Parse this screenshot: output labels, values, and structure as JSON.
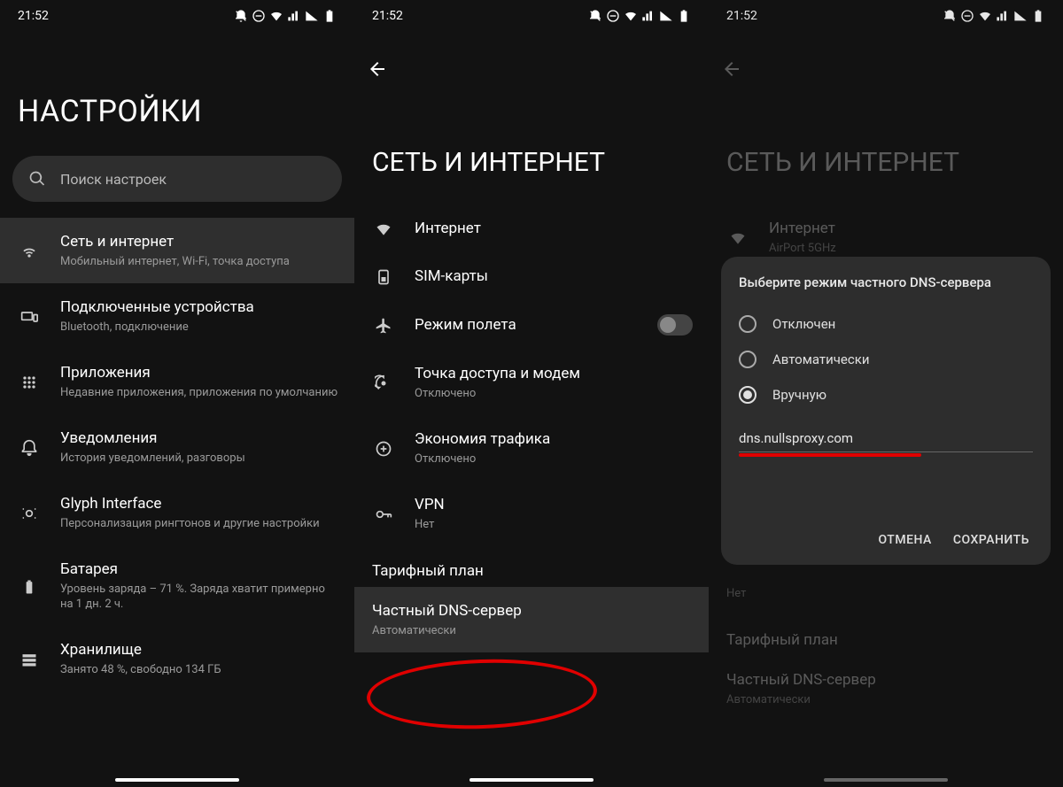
{
  "status": {
    "time": "21:52"
  },
  "screen1": {
    "title": "НАСТРОЙКИ",
    "search_placeholder": "Поиск настроек",
    "items": [
      {
        "title": "Сеть и интернет",
        "sub": "Мобильный интернет, Wi-Fi, точка доступа"
      },
      {
        "title": "Подключенные устройства",
        "sub": "Bluetooth, подключение"
      },
      {
        "title": "Приложения",
        "sub": "Недавние приложения, приложения по умолчанию"
      },
      {
        "title": "Уведомления",
        "sub": "История уведомлений, разговоры"
      },
      {
        "title": "Glyph Interface",
        "sub": "Персонализация рингтонов и другие настройки"
      },
      {
        "title": "Батарея",
        "sub": "Уровень заряда – 71 %. Заряда хватит примерно на 1 дн. 2 ч."
      },
      {
        "title": "Хранилище",
        "sub": "Занято 48 %, свободно 134 ГБ"
      }
    ]
  },
  "screen2": {
    "title": "СЕТЬ И ИНТЕРНЕТ",
    "items": [
      {
        "title": "Интернет",
        "sub": ""
      },
      {
        "title": "SIM-карты",
        "sub": ""
      },
      {
        "title": "Режим полета",
        "sub": ""
      },
      {
        "title": "Точка доступа и модем",
        "sub": "Отключено"
      },
      {
        "title": "Экономия трафика",
        "sub": "Отключено"
      },
      {
        "title": "VPN",
        "sub": "Нет"
      }
    ],
    "plan_label": "Тарифный план",
    "dns": {
      "title": "Частный DNS-сервер",
      "sub": "Автоматически"
    }
  },
  "screen3": {
    "title": "СЕТЬ И ИНТЕРНЕТ",
    "internet": {
      "title": "Интернет",
      "sub": "AirPort 5GHz"
    },
    "plan_label": "Тарифный план",
    "dns": {
      "title": "Частный DNS-сервер",
      "sub": "Автоматически"
    },
    "vpn_sub": "Нет",
    "dialog": {
      "title": "Выберите режим частного DNS-сервера",
      "opt_off": "Отключен",
      "opt_auto": "Автоматически",
      "opt_manual": "Вручную",
      "input": "dns.nullsproxy.com",
      "cancel": "ОТМЕНА",
      "save": "СОХРАНИТЬ"
    }
  }
}
